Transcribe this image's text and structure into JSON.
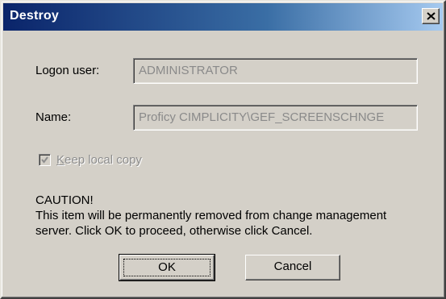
{
  "window": {
    "title": "Destroy",
    "close_icon": "close-x-icon"
  },
  "form": {
    "logon_user_label": "Logon user:",
    "logon_user_value": "ADMINISTRATOR",
    "name_label": "Name:",
    "name_value": "Proficy CIMPLICITY\\GEF_SCREENSCHNGE",
    "keep_local_copy": {
      "label_mnemonic": "K",
      "label_rest": "eep local copy",
      "checked": true,
      "enabled": false
    }
  },
  "message": {
    "heading": "CAUTION!",
    "line1": "This item will be permanently removed from change management",
    "line2": "server. Click OK to proceed, otherwise click Cancel."
  },
  "buttons": {
    "ok_label": "OK",
    "cancel_label": "Cancel"
  },
  "colors": {
    "titlebar_start": "#0a246a",
    "titlebar_end": "#a6caf0",
    "dialog_face": "#d4d0c8",
    "disabled_text": "#8a8a8a"
  }
}
